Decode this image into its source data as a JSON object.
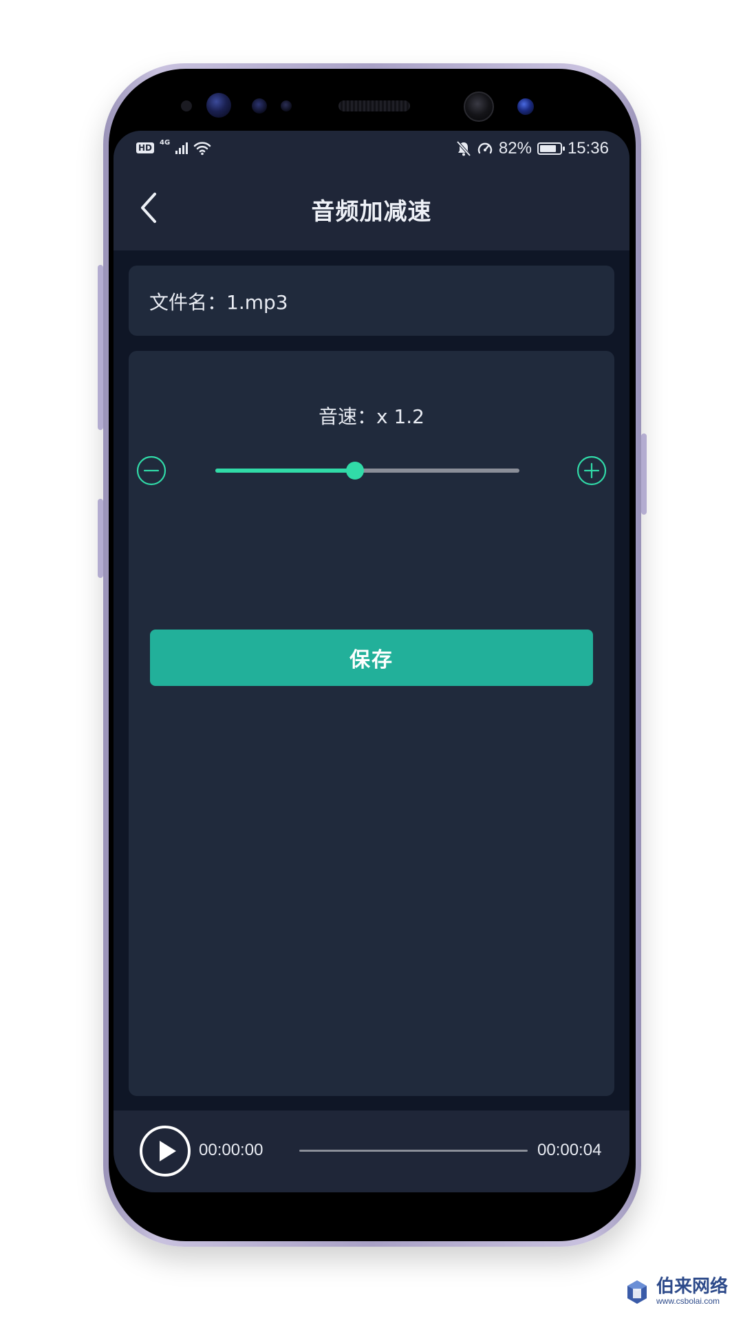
{
  "status_bar": {
    "hd_badge": "HD",
    "network": "4G",
    "battery_percent": "82%",
    "battery_level": 0.82,
    "time": "15:36",
    "icons": [
      "hd-icon",
      "signal-icon",
      "wifi-icon",
      "mute-bell-icon",
      "speedometer-icon",
      "battery-icon"
    ]
  },
  "header": {
    "title": "音频加减速",
    "back_icon": "chevron-left-icon"
  },
  "file": {
    "label": "文件名：1.mp3"
  },
  "speed": {
    "label": "音速：x 1.2",
    "slider_position": 0.46,
    "minus_icon": "minus-circle-icon",
    "plus_icon": "plus-circle-icon"
  },
  "actions": {
    "save_label": "保存"
  },
  "player": {
    "current_time": "00:00:00",
    "total_time": "00:00:04",
    "progress": 0.0,
    "play_icon": "play-icon"
  },
  "watermark": {
    "name": "伯来网络",
    "url": "www.csbolai.com"
  },
  "colors": {
    "accent": "#31dba8",
    "save_button": "#22b09a",
    "panel": "#202a3c",
    "background": "#0f1626",
    "header": "#1f2638",
    "text": "#e9ecf3"
  }
}
